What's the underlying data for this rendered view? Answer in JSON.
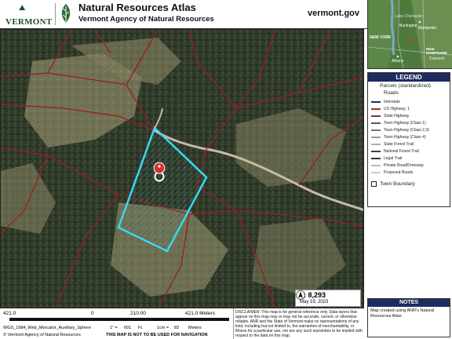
{
  "header": {
    "logo_text": "VERMONT",
    "title": "Natural Resources Atlas",
    "subtitle": "Vermont Agency of Natural Resources",
    "site": "vermont.gov"
  },
  "inset_labels": {
    "lake": "Lake Champlain",
    "montpelier": "Montpelier",
    "burlington": "Burlington",
    "concord": "Concord",
    "albany": "Albany",
    "new_york": "NEW YORK",
    "new_hampshire": "NEW HAMPSHIRE"
  },
  "legend": {
    "title": "LEGEND",
    "parcels": "Parcels (standardized)",
    "roads": "Roads",
    "items": [
      {
        "label": "Interstate",
        "color": "#1a2a6e"
      },
      {
        "label": "US Highway; 1",
        "color": "#b3282d"
      },
      {
        "label": "State Highway",
        "color": "#7a3a2a"
      },
      {
        "label": "Town Highway (Class 1)",
        "color": "#555555"
      },
      {
        "label": "Town Highway (Class 2,3)",
        "color": "#777777"
      },
      {
        "label": "Town Highway (Class 4)",
        "color": "#999999"
      },
      {
        "label": "State Forest Trail",
        "color": "#b0b0b0"
      },
      {
        "label": "National Forest Trail",
        "color": "#444444"
      },
      {
        "label": "Legal Trail",
        "color": "#333333"
      },
      {
        "label": "Private Road/Driveway",
        "color": "#bbbbbb"
      },
      {
        "label": "Proposed Roads",
        "color": "#cccccc"
      }
    ],
    "town_boundary": "Town Boundary"
  },
  "map": {
    "scale_ratio": "1:  8,293",
    "date": "May 19, 2023"
  },
  "notes": {
    "title": "NOTES",
    "text": "Map created using ANR's Natural Resources Atlas"
  },
  "scalebar": {
    "left": "421.0",
    "zero": "0",
    "mid": "210.00",
    "right": "421.0 Meters"
  },
  "footer": {
    "projection": "WGS_1984_Web_Mercator_Auxiliary_Sphere",
    "inch": "1\" =",
    "inch_val": "691",
    "inch_unit": "Ft.",
    "cm": "1cm =",
    "cm_val": "83",
    "cm_unit": "Meters",
    "copyright": "© Vermont Agency of Natural Resources",
    "nav_warning": "THIS MAP IS NOT TO BE USED FOR NAVIGATION",
    "disclaimer": "DISCLAIMER: This map is for general reference only. Data layers that appear on this map may or may not be accurate, current, or otherwise reliable. ANR and the State of Vermont make no representations of any kind, including but not limited to, the warranties of merchantability, or fitness for a particular use, nor are any such warranties to be implied with respect to the data on this map."
  }
}
